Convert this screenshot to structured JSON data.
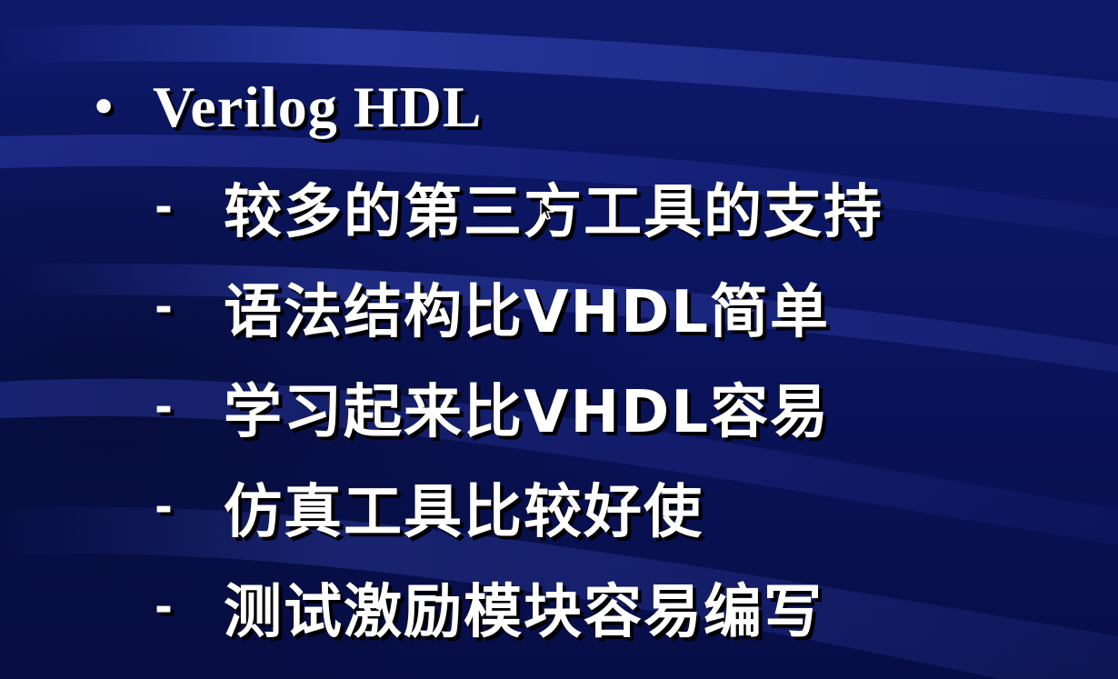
{
  "slide": {
    "bullet_symbol": "•",
    "heading": "Verilog HDL",
    "dash_symbol": "-",
    "sub_items": [
      {
        "text": "较多的第三方工具的支持"
      },
      {
        "text": "语法结构比VHDL简单"
      },
      {
        "text": "学习起来比VHDL容易"
      },
      {
        "text": "仿真工具比较好使"
      },
      {
        "text": "测试激励模块容易编写"
      }
    ]
  },
  "colors": {
    "background": "#0b1560",
    "text": "#ffffff",
    "shadow": "#000000",
    "swoosh": "#2a3aa8"
  },
  "icons": {
    "cursor": "mouse-pointer-icon"
  }
}
